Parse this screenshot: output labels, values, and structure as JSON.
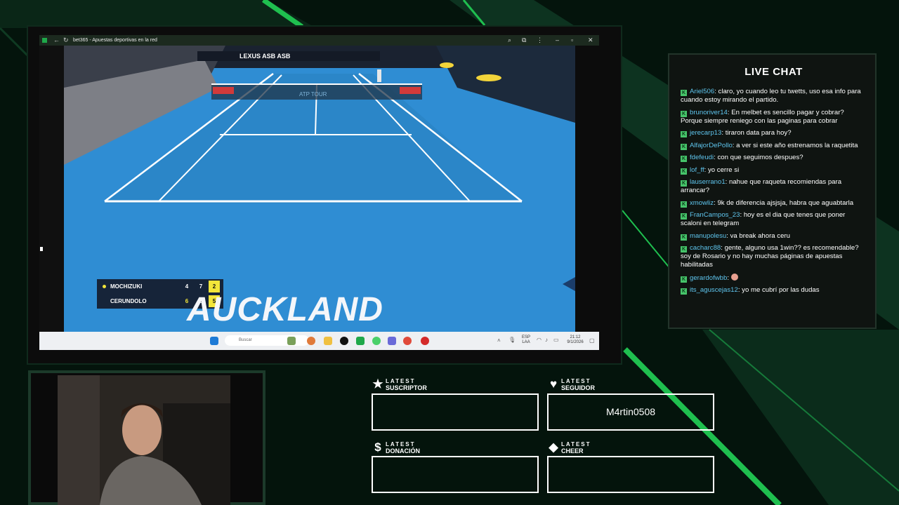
{
  "browser": {
    "tab_title": "bet365 - Apuestas deportivas en la red"
  },
  "scoreboard": {
    "players": [
      {
        "name": "MOCHIZUKI",
        "set1": "4",
        "set2": "7",
        "set3": "2",
        "serving": true
      },
      {
        "name": "CERUNDOLO",
        "set1": "6",
        "set2": "6",
        "set3": "5",
        "serving": false
      }
    ],
    "venue_text": "AUCKLAND",
    "court_sponsor": "ATP TOUR"
  },
  "taskbar": {
    "search_placeholder": "Buscar",
    "lang_line1": "ESP",
    "lang_line2": "LAA",
    "time": "21:12",
    "date": "9/1/2026"
  },
  "chat": {
    "title": "LIVE CHAT",
    "badge_letter": "K",
    "messages": [
      {
        "user": "Ariel506",
        "text": "claro, yo cuando leo tu twetts, uso esa info para cuando estoy mirando el partido."
      },
      {
        "user": "brunoriver14",
        "text": "En melbet es sencillo pagar y cobrar? Porque siempre reniego con las paginas para cobrar"
      },
      {
        "user": "jerecarp13",
        "text": "tiraron data para hoy?"
      },
      {
        "user": "AlfajorDePollo",
        "text": "a ver si este año estrenamos la raquetita"
      },
      {
        "user": "fdefeudi",
        "text": "con que seguimos despues?"
      },
      {
        "user": "lof_ff",
        "text": "yo cerre si"
      },
      {
        "user": "lauserrano1",
        "text": "nahue que raqueta recomiendas para arrancar?"
      },
      {
        "user": "xmowliz",
        "text": "9k de diferencia ajsjsja, habra que aguabtarla"
      },
      {
        "user": "FranCampos_23",
        "text": "hoy es el dia que tenes que poner scaloni en telegram"
      },
      {
        "user": "manupolesu",
        "text": "va break ahora ceru"
      },
      {
        "user": "cacharc88",
        "text": "gente, alguno usa 1win?? es recomendable? soy de Rosario y no hay muchas páginas de apuestas habilitadas"
      },
      {
        "user": "gerardofwbb",
        "text": "",
        "emote": true
      },
      {
        "user": "its_aguscejas12",
        "text": "yo me cubrí por las dudas"
      }
    ]
  },
  "widgets": {
    "latest_label": "LATEST",
    "suscriptor": {
      "kind": "SUSCRIPTOR",
      "value": ""
    },
    "seguidor": {
      "kind": "SEGUIDOR",
      "value": "M4rtin0508"
    },
    "donacion": {
      "kind": "DONACIÓN",
      "value": ""
    },
    "cheer": {
      "kind": "CHEER",
      "value": ""
    }
  },
  "colors": {
    "accent_green": "#1fbf4f",
    "chat_username": "#5fc6ef",
    "court_blue": "#2e8ad0",
    "score_highlight": "#f2e53a"
  }
}
